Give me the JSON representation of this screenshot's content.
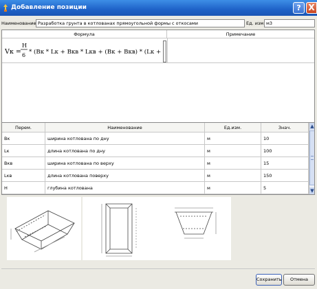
{
  "window": {
    "title": "Добавление позиции",
    "help_label": "?",
    "close_label": "X"
  },
  "name_row": {
    "name_label": "Наименование:",
    "name_value": "Разработка грунта в котлованах прямоугольной формы с откосами",
    "unit_label": "Ед. изм.",
    "unit_value": "м3"
  },
  "formula_panel": {
    "formula_header": "Формула",
    "note_header": "Примечание",
    "formula": {
      "lhs": "Vк =",
      "frac_num": "H",
      "frac_den": "6",
      "rhs": "* (Bк * Lк + Bкв * Lкв + (Bк + Bкв) * (Lк + Lкв))"
    },
    "note_value": ""
  },
  "params_table": {
    "columns": [
      "Перем.",
      "Наименование",
      "Ед.изм.",
      "Знач."
    ],
    "rows": [
      {
        "var": "Bк",
        "name": "ширина котлована по дну",
        "unit": "м",
        "value": "10"
      },
      {
        "var": "Lк",
        "name": "длина котлована по дну",
        "unit": "м",
        "value": "100"
      },
      {
        "var": "Bкв",
        "name": "ширина котлована по верху",
        "unit": "м",
        "value": "15"
      },
      {
        "var": "Lкв",
        "name": "длина котлована поверху",
        "unit": "м",
        "value": "150"
      },
      {
        "var": "H",
        "name": "глубина котлована",
        "unit": "м",
        "value": "5"
      }
    ]
  },
  "sketches": [
    {
      "icon": "pit-3d-sketch-icon"
    },
    {
      "icon": "pit-plan-sketch-icon"
    },
    {
      "icon": "pit-section-sketch-icon"
    }
  ],
  "buttons": {
    "save_label": "Сохранить",
    "cancel_label": "Отмена"
  },
  "colors": {
    "titlebar": "#1f62c8",
    "close_button": "#c9441f",
    "window_bg": "#ebeae3"
  }
}
